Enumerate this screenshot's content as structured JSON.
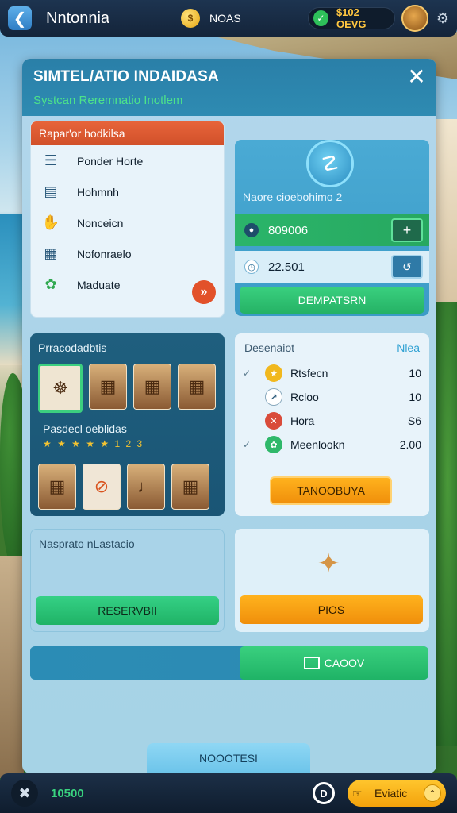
{
  "topbar": {
    "app_title": "Nntonnia",
    "coin_label": "NOAS",
    "wallet_amount": "$102 OEVG"
  },
  "modal": {
    "title": "SIMTEL/ATIO INDAIDASA",
    "subtitle": "Systcan Reremnatio Inotlem"
  },
  "panel_list": {
    "header": "Rapar'or hodkilsa",
    "items": [
      {
        "label": "Ponder Horte",
        "icon": "list-icon"
      },
      {
        "label": "Hohmnh",
        "icon": "note-icon"
      },
      {
        "label": "Nonceicn",
        "icon": "ticket-icon"
      },
      {
        "label": "Nofonraelo",
        "icon": "basket-icon"
      },
      {
        "label": "Maduate",
        "icon": "leaf-icon"
      }
    ]
  },
  "panel_stats": {
    "label": "Naore cioebohimo 2",
    "row1_value": "809006",
    "row2_value": "22.501",
    "cta": "DEMPATSRN"
  },
  "panel_gallery": {
    "title": "Prracodadbtis",
    "subtitle": "Pasdecl oeblidas",
    "stars": "★ ★ ★ ★ ★ 1 2 3"
  },
  "panel_values": {
    "title": "Desenaiot",
    "link": "Nlea",
    "rows": [
      {
        "label": "Rtsfecn",
        "value": "10",
        "color": "#f1b81e"
      },
      {
        "label": "Rcloo",
        "value": "10",
        "color": "#ffffff"
      },
      {
        "label": "Hora",
        "value": "S6",
        "color": "#d94b3a"
      },
      {
        "label": "Meenlookn",
        "value": "2.00",
        "color": "#2fb86a"
      }
    ],
    "cta": "TANOOBUYA"
  },
  "panel_reserve": {
    "label": "Nasprato nLastacio",
    "button": "RESERVBII"
  },
  "panel_pros": {
    "button": "PIOS"
  },
  "action_bar": {
    "button": "CAOOV"
  },
  "note_button": "NOOOTESI",
  "bottombar": {
    "count": "10500",
    "pill_label": "Eviatic"
  }
}
